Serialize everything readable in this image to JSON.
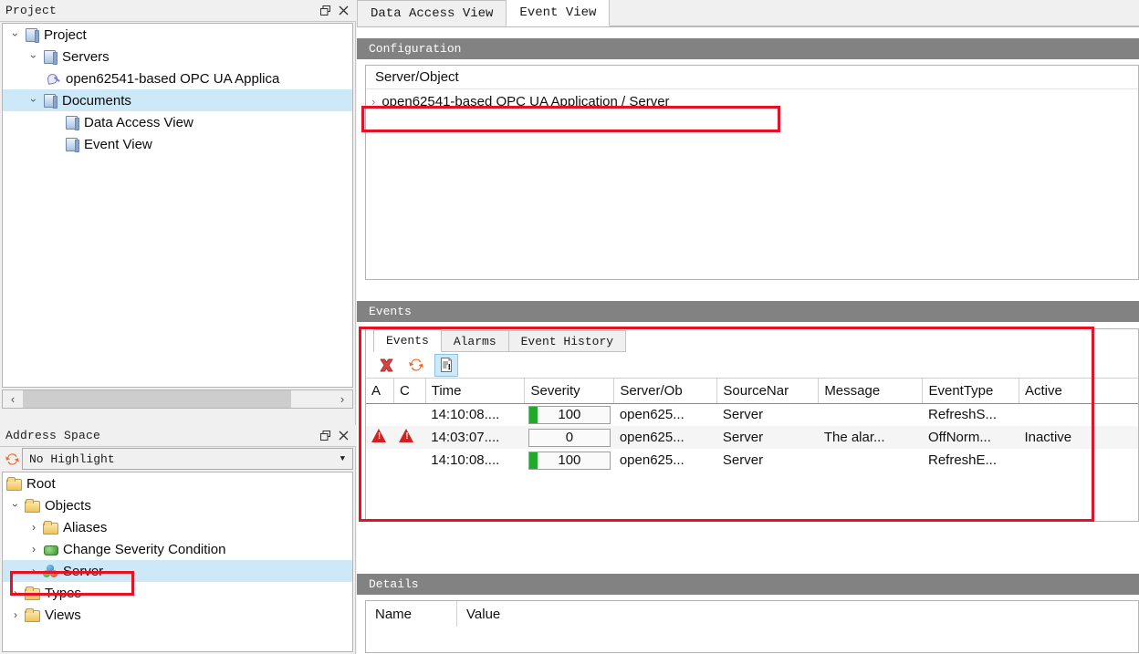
{
  "project_panel": {
    "title": "Project",
    "float_icon": "restore-icon",
    "close_icon": "close-icon",
    "tree": [
      {
        "label": "Project",
        "depth": 0,
        "expander": "down",
        "icon": "document-icon",
        "selected": false
      },
      {
        "label": "Servers",
        "depth": 1,
        "expander": "down",
        "icon": "document-icon",
        "selected": false
      },
      {
        "label": "open62541-based OPC UA Applica",
        "depth": 2,
        "expander": "none",
        "icon": "plug-icon",
        "selected": false
      },
      {
        "label": "Documents",
        "depth": 1,
        "expander": "down",
        "icon": "document-icon",
        "selected": true
      },
      {
        "label": "Data Access View",
        "depth": 2,
        "expander": "none",
        "icon": "document-icon",
        "selected": false
      },
      {
        "label": "Event View",
        "depth": 2,
        "expander": "none",
        "icon": "document-icon",
        "selected": false
      }
    ],
    "scroll_left_arrow": "‹",
    "scroll_right_arrow": "›"
  },
  "address_space_panel": {
    "title": "Address Space",
    "float_icon": "restore-icon",
    "close_icon": "close-icon",
    "refresh_icon": "refresh-icon",
    "highlight_select": {
      "value": "No Highlight",
      "arrow": "▼",
      "options": [
        "No Highlight"
      ]
    },
    "tree": [
      {
        "label": "Root",
        "depth": 0,
        "expander": "none",
        "icon": "folder-icon",
        "selected": false
      },
      {
        "label": "Objects",
        "depth": 0,
        "expander": "down",
        "icon": "folder-icon",
        "selected": false
      },
      {
        "label": "Aliases",
        "depth": 1,
        "expander": "right",
        "icon": "folder-icon",
        "selected": false
      },
      {
        "label": "Change Severity Condition",
        "depth": 1,
        "expander": "right",
        "icon": "condition-icon",
        "selected": false
      },
      {
        "label": "Server",
        "depth": 1,
        "expander": "right",
        "icon": "server-icon",
        "selected": true
      },
      {
        "label": "Types",
        "depth": 0,
        "expander": "right",
        "icon": "folder-icon",
        "selected": false
      },
      {
        "label": "Views",
        "depth": 0,
        "expander": "right",
        "icon": "folder-icon",
        "selected": false
      }
    ]
  },
  "document_tabs": [
    {
      "label": "Data Access View",
      "active": false
    },
    {
      "label": "Event View",
      "active": true
    }
  ],
  "configuration": {
    "header": "Configuration",
    "column_header": "Server/Object",
    "rows": [
      {
        "label": "open62541-based OPC UA Application / Server",
        "expander": "›"
      }
    ]
  },
  "events_section": {
    "header": "Events",
    "tabs": [
      {
        "label": "Events",
        "active": true
      },
      {
        "label": "Alarms",
        "active": false
      },
      {
        "label": "Event History",
        "active": false
      }
    ],
    "toolbar": [
      {
        "name": "clear-events-button",
        "icon": "red-x-icon",
        "selected": false
      },
      {
        "name": "refresh-events-button",
        "icon": "refresh-icon",
        "selected": false
      },
      {
        "name": "auto-scroll-button",
        "icon": "document-scroll-icon",
        "selected": true
      }
    ],
    "columns": [
      "A",
      "C",
      "Time",
      "Severity",
      "Server/Ob",
      "SourceNar",
      "Message",
      "EventType",
      "Active"
    ],
    "rows": [
      {
        "a_icon": "",
        "c_icon": "",
        "time": "14:10:08....",
        "severity": "100",
        "severity_pct": 100,
        "server_object": "open625...",
        "source_name": "Server",
        "message": "",
        "event_type": "RefreshS...",
        "active": ""
      },
      {
        "a_icon": "warning-icon",
        "c_icon": "warning-icon",
        "time": "14:03:07....",
        "severity": "0",
        "severity_pct": 0,
        "server_object": "open625...",
        "source_name": "Server",
        "message": "The alar...",
        "event_type": "OffNorm...",
        "active": "Inactive"
      },
      {
        "a_icon": "",
        "c_icon": "",
        "time": "14:10:08....",
        "severity": "100",
        "severity_pct": 100,
        "server_object": "open625...",
        "source_name": "Server",
        "message": "",
        "event_type": "RefreshE...",
        "active": ""
      }
    ]
  },
  "details_section": {
    "header": "Details",
    "columns": [
      "Name",
      "Value"
    ],
    "rows": []
  },
  "colors": {
    "section_header_bg": "#828282",
    "selection_blue": "#cde8f7",
    "annotation_red": "#e81123",
    "severity_green": "#1faa2a",
    "warning_red": "#d32020",
    "refresh_orange": "#ef6a1e"
  }
}
